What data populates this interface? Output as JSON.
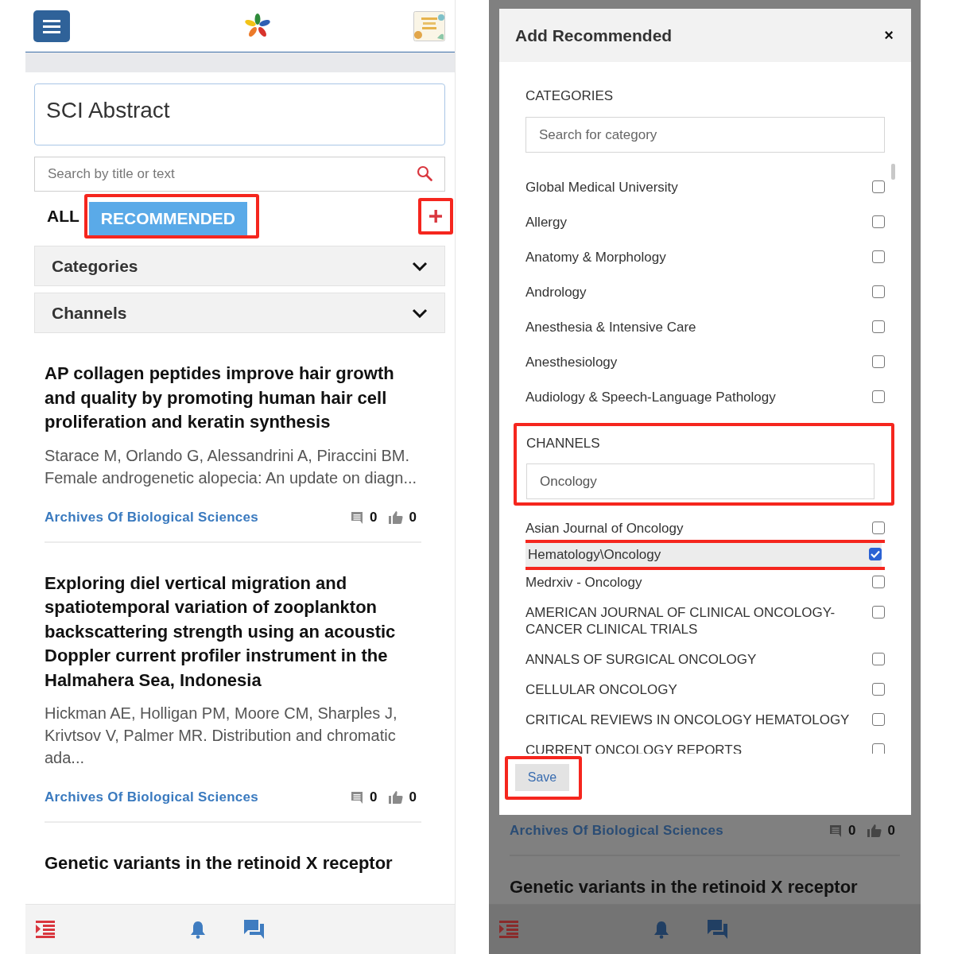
{
  "feed_screen": {
    "title_field": {
      "value": "SCI Abstract"
    },
    "search": {
      "placeholder": "Search by title or text"
    },
    "tabs": [
      {
        "label": "ALL",
        "selected": false
      },
      {
        "label": "RECOMMENDED",
        "selected": true
      }
    ],
    "accordions": [
      {
        "label": "Categories",
        "expanded": false
      },
      {
        "label": "Channels",
        "expanded": false
      }
    ],
    "articles": [
      {
        "title": "AP collagen peptides improve hair growth and quality by promoting human hair cell proliferation and keratin synthesis",
        "snippet": "Starace M, Orlando G, Alessandrini A, Piraccini BM. Female androgenetic alopecia: An update on diagn...",
        "source": "Archives Of Biological Sciences",
        "comments": "0",
        "likes": "0"
      },
      {
        "title": "Exploring diel vertical migration and spatiotemporal variation of zooplankton backscattering strength using an acoustic Doppler current profiler instrument in the Halmahera Sea, Indonesia",
        "snippet": "Hickman AE, Holligan PM, Moore CM, Sharples J, Krivtsov V, Palmer MR. Distribution and chromatic ada...",
        "source": "Archives Of Biological Sciences",
        "comments": "0",
        "likes": "0"
      },
      {
        "title": "Genetic variants in the retinoid X receptor"
      }
    ]
  },
  "modal_screen": {
    "modal": {
      "title": "Add Recommended",
      "close": "×",
      "categories_label": "CATEGORIES",
      "category_search": {
        "placeholder": "Search for category"
      },
      "categories": [
        {
          "name": "Global Medical University",
          "checked": false
        },
        {
          "name": "Allergy",
          "checked": false
        },
        {
          "name": "Anatomy & Morphology",
          "checked": false
        },
        {
          "name": "Andrology",
          "checked": false
        },
        {
          "name": "Anesthesia & Intensive Care",
          "checked": false
        },
        {
          "name": "Anesthesiology",
          "checked": false
        },
        {
          "name": "Audiology & Speech-Language Pathology",
          "checked": false
        }
      ],
      "channels_label": "CHANNELS",
      "channel_search": {
        "value": "Oncology"
      },
      "channels": [
        {
          "name": "Asian Journal of Oncology",
          "checked": false
        },
        {
          "name": "Hematology\\Oncology",
          "checked": true
        },
        {
          "name": "Medrxiv - Oncology",
          "checked": false
        },
        {
          "name": "AMERICAN JOURNAL OF CLINICAL ONCOLOGY-CANCER CLINICAL TRIALS",
          "checked": false
        },
        {
          "name": "ANNALS OF SURGICAL ONCOLOGY",
          "checked": false
        },
        {
          "name": "CELLULAR ONCOLOGY",
          "checked": false
        },
        {
          "name": "CRITICAL REVIEWS IN ONCOLOGY HEMATOLOGY",
          "checked": false
        },
        {
          "name": "CURRENT ONCOLOGY REPORTS",
          "checked": false
        }
      ],
      "save": "Save"
    },
    "background_articles": [
      {
        "source": "Archives Of Biological Sciences",
        "comments": "0",
        "likes": "0"
      },
      {
        "title": "Genetic variants in the retinoid X receptor"
      }
    ]
  }
}
